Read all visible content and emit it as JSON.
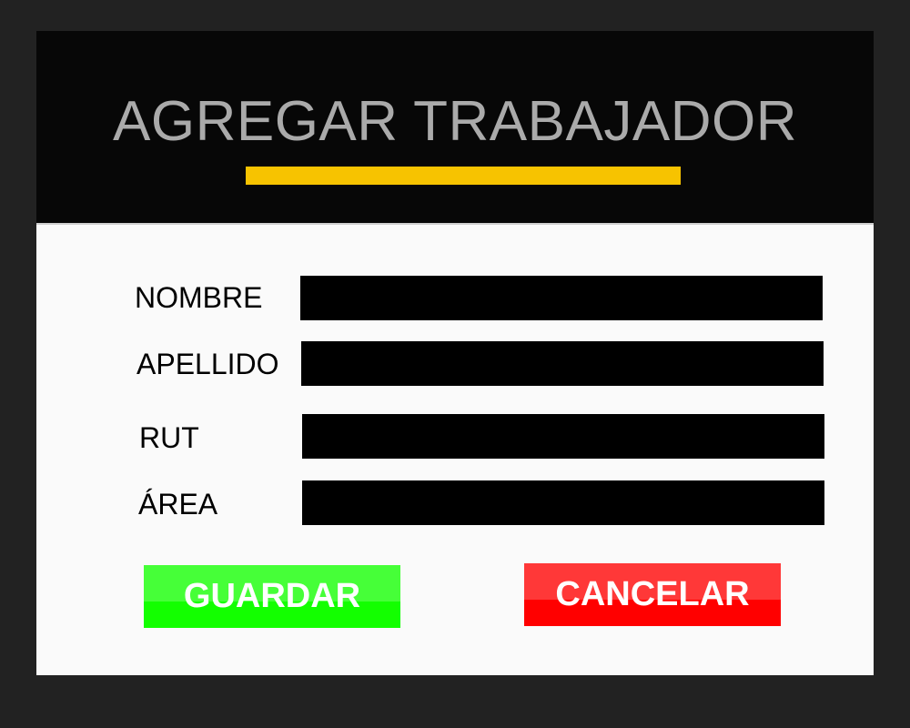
{
  "dialog": {
    "title": "AGREGAR TRABAJADOR",
    "accent_color": "#f7c300"
  },
  "form": {
    "fields": [
      {
        "label": "NOMBRE",
        "value": ""
      },
      {
        "label": "APELLIDO",
        "value": ""
      },
      {
        "label": "RUT",
        "value": ""
      },
      {
        "label": "ÁREA",
        "value": ""
      }
    ]
  },
  "buttons": {
    "save": {
      "label": "GUARDAR",
      "color": "#13ff00"
    },
    "cancel": {
      "label": "CANCELAR",
      "color": "#ff0000"
    }
  }
}
